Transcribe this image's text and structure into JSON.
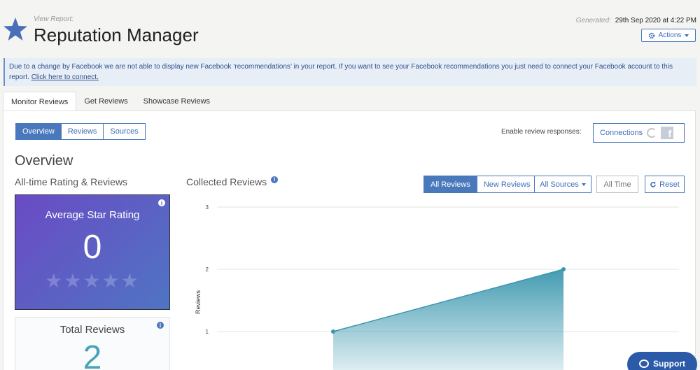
{
  "header": {
    "view_report_label": "View Report:",
    "title": "Reputation Manager",
    "generated_label": "Generated:",
    "generated_value": "29th Sep 2020 at 4:22 PM",
    "actions_label": "Actions"
  },
  "notice": {
    "text": "Due to a change by Facebook we are not able to display new Facebook ‘recommendations’ in your report. If you want to see your Facebook recommendations you just need to connect your Facebook account to this report.",
    "link": "Click here to connect."
  },
  "tabs": [
    {
      "label": "Monitor Reviews",
      "active": true
    },
    {
      "label": "Get Reviews",
      "active": false
    },
    {
      "label": "Showcase Reviews",
      "active": false
    }
  ],
  "subnav": [
    {
      "label": "Overview",
      "active": true
    },
    {
      "label": "Reviews",
      "active": false
    },
    {
      "label": "Sources",
      "active": false
    }
  ],
  "responses": {
    "label": "Enable review responses:",
    "connections_label": "Connections",
    "google_icon": "google-icon",
    "facebook_icon": "facebook-icon"
  },
  "overview": {
    "title": "Overview",
    "alltime_title": "All-time Rating & Reviews",
    "rating_card": {
      "title": "Average Star Rating",
      "value": "0",
      "stars_filled": 0,
      "stars_total": 5
    },
    "total_card": {
      "title": "Total Reviews",
      "value": "2"
    }
  },
  "collected": {
    "title": "Collected Reviews",
    "filter_all": "All Reviews",
    "filter_new": "New Reviews",
    "sources_label": "All Sources",
    "time_label": "All Time",
    "reset_label": "Reset"
  },
  "colors": {
    "accent": "#4a78bd",
    "chart_line": "#3a96ae",
    "card_gradient_start": "#6a4bc4",
    "card_gradient_end": "#4f74c4"
  },
  "chart_data": {
    "type": "area",
    "ylabel": "Reviews",
    "ylim": [
      0,
      3
    ],
    "yticks": [
      "1",
      "2",
      "3"
    ],
    "x": [
      1,
      2
    ],
    "values": [
      1,
      2
    ],
    "grid": true
  },
  "support": {
    "label": "Support"
  }
}
